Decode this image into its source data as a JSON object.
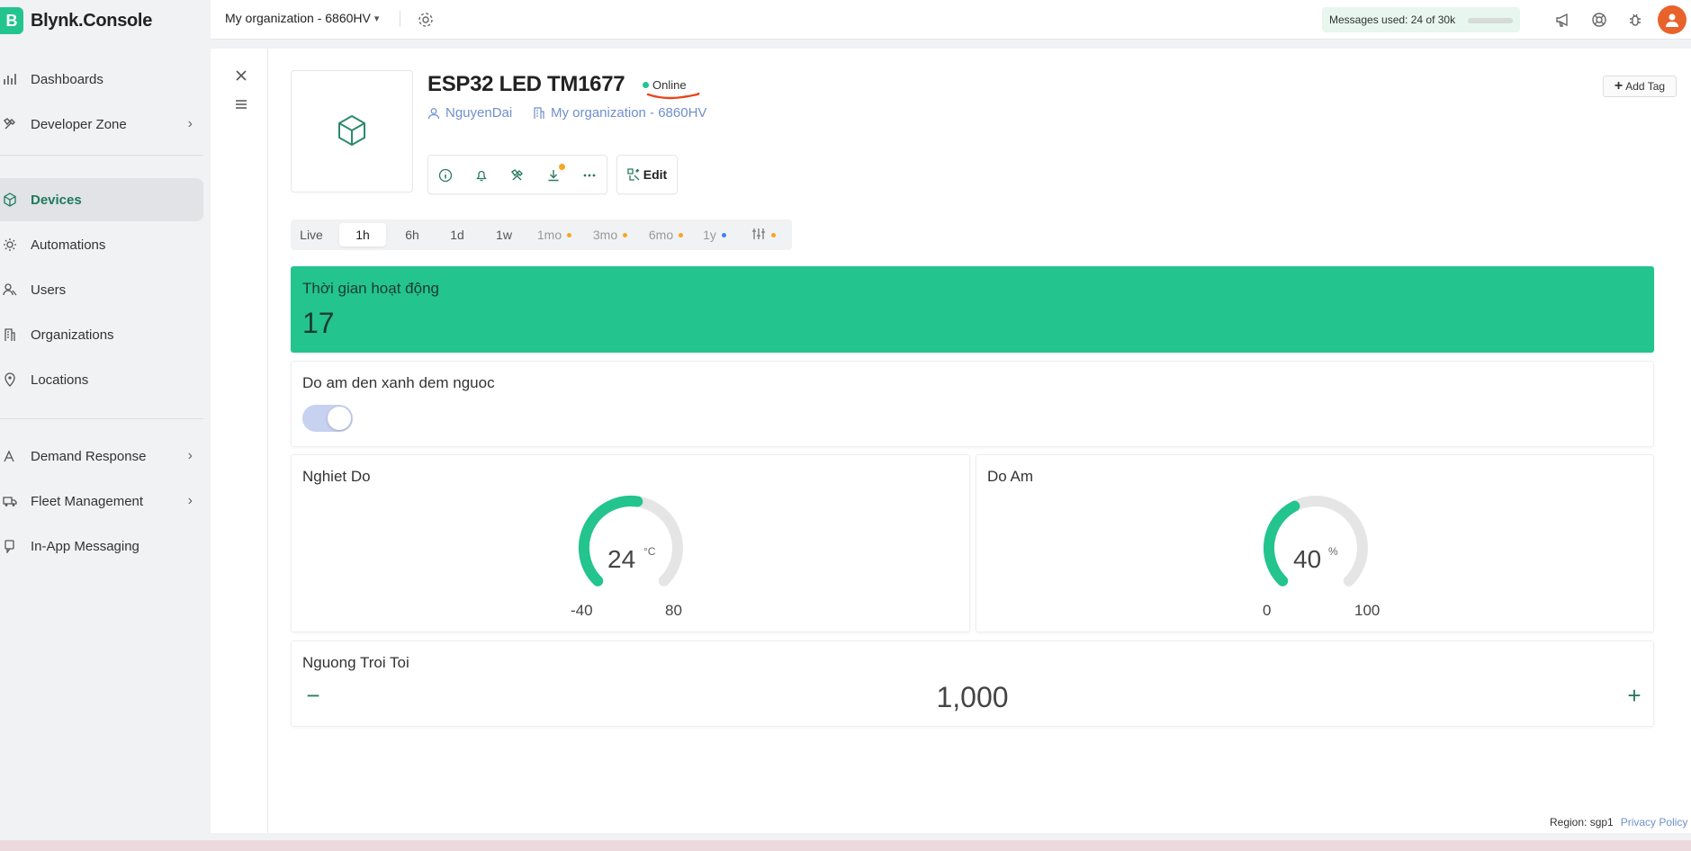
{
  "app": {
    "logo_letter": "B",
    "name": "Blynk.Console"
  },
  "sidebar": {
    "items": [
      {
        "label": "Dashboards",
        "icon": "chart-bar-icon"
      },
      {
        "label": "Developer Zone",
        "icon": "tools-icon",
        "has_children": true
      },
      {
        "label": "Devices",
        "icon": "cube-icon",
        "active": true
      },
      {
        "label": "Automations",
        "icon": "sun-gear-icon"
      },
      {
        "label": "Users",
        "icon": "users-icon"
      },
      {
        "label": "Organizations",
        "icon": "building-icon"
      },
      {
        "label": "Locations",
        "icon": "pin-icon"
      },
      {
        "label": "Demand Response",
        "icon": "signal-icon",
        "has_children": true
      },
      {
        "label": "Fleet Management",
        "icon": "truck-icon",
        "has_children": true
      },
      {
        "label": "In-App Messaging",
        "icon": "message-icon"
      }
    ]
  },
  "topbar": {
    "org_name": "My organization - 6860HV",
    "messages_label": "Messages used:",
    "messages_value": "24 of 30k",
    "icons": [
      "megaphone-icon",
      "lifebuoy-icon",
      "bug-icon"
    ]
  },
  "device": {
    "title": "ESP32 LED TM1677",
    "status": "Online",
    "owner": "NguyenDai",
    "organization": "My organization - 6860HV",
    "edit_label": "Edit",
    "add_tag_label": "Add Tag",
    "action_icons": [
      "info-icon",
      "bell-icon",
      "tools-icon",
      "download-icon",
      "more-icon"
    ]
  },
  "time_ranges": [
    {
      "label": "Live"
    },
    {
      "label": "1h",
      "selected": true
    },
    {
      "label": "6h"
    },
    {
      "label": "1d"
    },
    {
      "label": "1w"
    },
    {
      "label": "1mo",
      "dim": true,
      "dot": "#f5a623"
    },
    {
      "label": "3mo",
      "dim": true,
      "dot": "#f5a623"
    },
    {
      "label": "6mo",
      "dim": true,
      "dot": "#f5a623"
    },
    {
      "label": "1y",
      "dim": true,
      "dot": "#3b82f6"
    }
  ],
  "widgets": {
    "uptime": {
      "title": "Thời gian hoạt động",
      "value": "17"
    },
    "switch": {
      "title": "Do am den xanh dem nguoc",
      "on": true
    },
    "temp": {
      "title": "Nghiet Do",
      "value": "24",
      "unit": "°C",
      "min": "-40",
      "max": "80",
      "fraction": 0.53
    },
    "humidity": {
      "title": "Do Am",
      "value": "40",
      "unit": "%",
      "min": "0",
      "max": "100",
      "fraction": 0.4
    },
    "threshold": {
      "title": "Nguong Troi Toi",
      "value": "1,000",
      "minus": "−",
      "plus": "+"
    }
  },
  "colors": {
    "accent": "#23c48e",
    "link": "#6f8fce",
    "badge": "#f5a623"
  },
  "footer": {
    "region": "Region: sgp1",
    "privacy": "Privacy Policy"
  }
}
